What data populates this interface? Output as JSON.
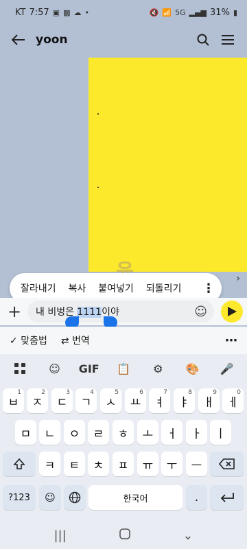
{
  "statusbar": {
    "carrier": "KT",
    "time": "7:57",
    "battery": "31%",
    "network": "5G"
  },
  "appbar": {
    "title": "yoon"
  },
  "chat": {
    "watermark": "윤",
    "scroll_hint": "›"
  },
  "context_menu": {
    "items": [
      "잘라내기",
      "복사",
      "붙여넣기",
      "되돌리기"
    ]
  },
  "input": {
    "text_before": "내 비벙은 ",
    "selected": "1111",
    "text_after": "이야"
  },
  "suggest_bar": {
    "spellcheck": "맞춤법",
    "translate": "번역"
  },
  "keyboard": {
    "toolbar_gif": "GIF",
    "row1": [
      {
        "k": "ㅂ",
        "n": "1"
      },
      {
        "k": "ㅈ",
        "n": "2"
      },
      {
        "k": "ㄷ",
        "n": "3"
      },
      {
        "k": "ㄱ",
        "n": "4"
      },
      {
        "k": "ㅅ",
        "n": "5"
      },
      {
        "k": "ㅛ",
        "n": "6"
      },
      {
        "k": "ㅕ",
        "n": "7"
      },
      {
        "k": "ㅑ",
        "n": "8"
      },
      {
        "k": "ㅐ",
        "n": "9"
      },
      {
        "k": "ㅔ",
        "n": "0"
      }
    ],
    "row2": [
      "ㅁ",
      "ㄴ",
      "ㅇ",
      "ㄹ",
      "ㅎ",
      "ㅗ",
      "ㅓ",
      "ㅏ",
      "ㅣ"
    ],
    "row3": [
      "ㅋ",
      "ㅌ",
      "ㅊ",
      "ㅍ",
      "ㅠ",
      "ㅜ",
      "ㅡ"
    ],
    "symbols_key": "?123",
    "space_key": "한국어",
    "period_key": "."
  }
}
